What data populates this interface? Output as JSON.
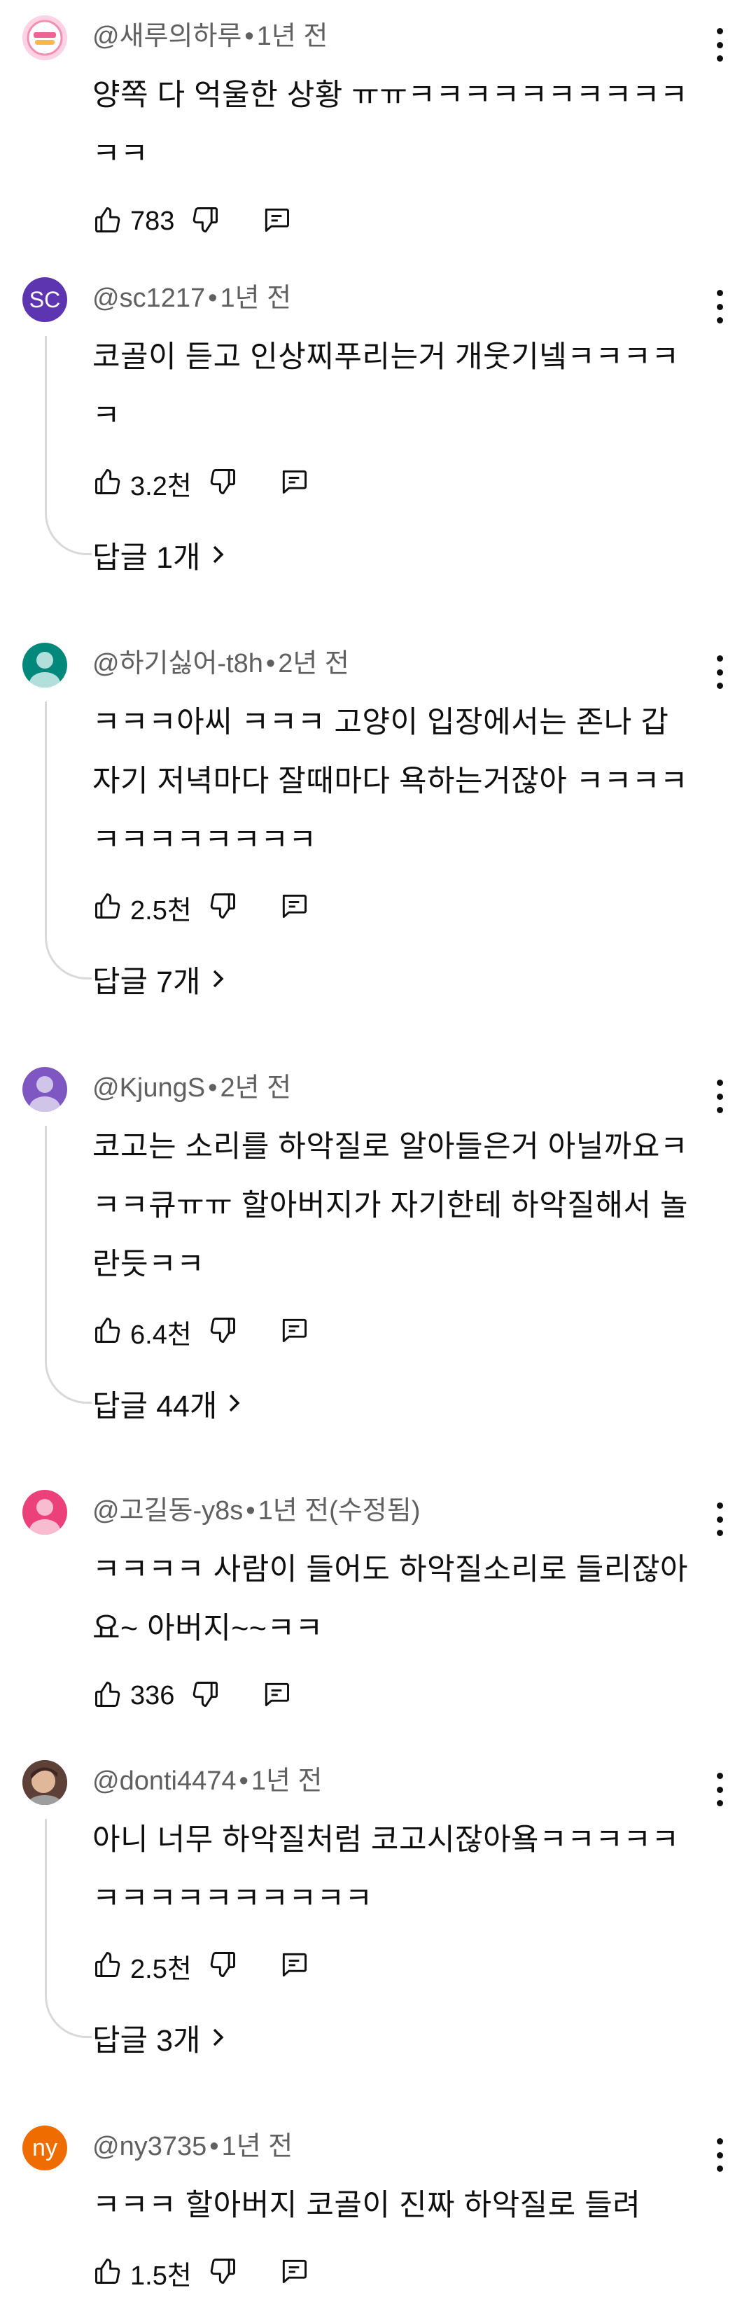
{
  "comments": [
    {
      "author": "@새루의하루",
      "time": "1년 전",
      "text": "양쪽 다 억울한 상황 ㅠㅠㅋㅋㅋㅋㅋㅋㅋㅋㅋㅋㅋㅋ",
      "likes": "783",
      "avatar": {
        "type": "image",
        "color": "#f7c6d9",
        "letter": ""
      },
      "replies": ""
    },
    {
      "author": "@sc1217",
      "time": "1년 전",
      "text": "코골이 듣고 인상찌푸리는거 개웃기넼ㅋㅋㅋㅋㅋ",
      "likes": "3.2천",
      "avatar": {
        "type": "letter",
        "color": "#5e35b1",
        "letter": "SC"
      },
      "replies": "답글 1개"
    },
    {
      "author": "@하기싫어-t8h",
      "time": "2년 전",
      "text": "ㅋㅋㅋ아씨 ㅋㅋㅋ 고양이 입장에서는 존나 갑자기 저녁마다 잘때마다 욕하는거잖아 ㅋㅋㅋㅋㅋㅋㅋㅋㅋㅋㅋㅋ",
      "likes": "2.5천",
      "avatar": {
        "type": "person",
        "color": "#00897b",
        "letter": ""
      },
      "replies": "답글 7개"
    },
    {
      "author": "@KjungS",
      "time": "2년 전",
      "text": "코고는 소리를 하악질로 알아들은거 아닐까요ㅋㅋㅋ큐ㅠㅠ 할아버지가 자기한테 하악질해서 놀란듯ㅋㅋ",
      "likes": "6.4천",
      "avatar": {
        "type": "person",
        "color": "#7e57c2",
        "letter": ""
      },
      "replies": "답글 44개"
    },
    {
      "author": "@고길동-y8s",
      "time": "1년 전(수정됨)",
      "text": "ㅋㅋㅋㅋ 사람이 들어도 하악질소리로 들리잖아요~ 아버지~~ㅋㅋ",
      "likes": "336",
      "avatar": {
        "type": "person",
        "color": "#ec407a",
        "letter": ""
      },
      "replies": ""
    },
    {
      "author": "@donti4474",
      "time": "1년 전",
      "text": "아니 너무 하악질처럼 코고시잖아욬ㅋㅋㅋㅋㅋㅋㅋㅋㅋㅋㅋㅋㅋㅋㅋ",
      "likes": "2.5천",
      "avatar": {
        "type": "image",
        "color": "#8d6e63",
        "letter": ""
      },
      "replies": "답글 3개"
    },
    {
      "author": "@ny3735",
      "time": "1년 전",
      "text": "ㅋㅋㅋ 할아버지 코골이 진짜 하악질로 들려",
      "likes": "1.5천",
      "avatar": {
        "type": "letter",
        "color": "#ef6c00",
        "letter": "ny"
      },
      "replies": ""
    }
  ]
}
